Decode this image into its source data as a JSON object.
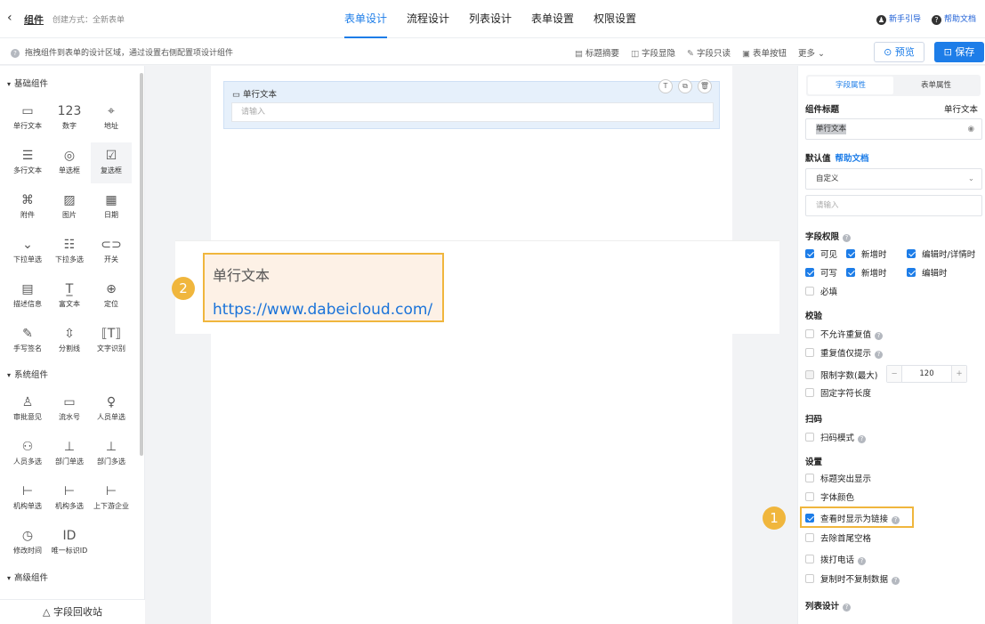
{
  "header": {
    "back_icon": "chevron-left-icon",
    "title": "组件",
    "create_mode": "创建方式：全新表单",
    "tabs": [
      "表单设计",
      "流程设计",
      "列表设计",
      "表单设置",
      "权限设置"
    ],
    "active_tab": "表单设计",
    "guide": "新手引导",
    "help": "帮助文档"
  },
  "toolbar": {
    "hint": "拖拽组件到表单的设计区域，通过设置右侧配置项设计组件",
    "tools": [
      "标题摘要",
      "字段显隐",
      "字段只读",
      "表单按钮",
      "更多"
    ],
    "preview": "预览",
    "save": "保存"
  },
  "left": {
    "basic_title": "基础组件",
    "basic": [
      {
        "label": "单行文本",
        "icon": "▭"
      },
      {
        "label": "数字",
        "icon": "123"
      },
      {
        "label": "地址",
        "icon": "⌖"
      },
      {
        "label": "多行文本",
        "icon": "☰"
      },
      {
        "label": "单选框",
        "icon": "◎"
      },
      {
        "label": "复选框",
        "icon": "☑"
      },
      {
        "label": "附件",
        "icon": "⌘"
      },
      {
        "label": "图片",
        "icon": "▨"
      },
      {
        "label": "日期",
        "icon": "▦"
      },
      {
        "label": "下拉单选",
        "icon": "⌄"
      },
      {
        "label": "下拉多选",
        "icon": "☷"
      },
      {
        "label": "开关",
        "icon": "⊂⊃"
      },
      {
        "label": "描述信息",
        "icon": "▤"
      },
      {
        "label": "富文本",
        "icon": "T̲"
      },
      {
        "label": "定位",
        "icon": "⊕"
      },
      {
        "label": "手写签名",
        "icon": "✎"
      },
      {
        "label": "分割线",
        "icon": "⇳"
      },
      {
        "label": "文字识别",
        "icon": "⟦T⟧"
      }
    ],
    "system_title": "系统组件",
    "system": [
      {
        "label": "审批意见",
        "icon": "♙"
      },
      {
        "label": "流水号",
        "icon": "▭"
      },
      {
        "label": "人员单选",
        "icon": "♀"
      },
      {
        "label": "人员多选",
        "icon": "⚇"
      },
      {
        "label": "部门单选",
        "icon": "⊥"
      },
      {
        "label": "部门多选",
        "icon": "⊥"
      },
      {
        "label": "机构单选",
        "icon": "⊢"
      },
      {
        "label": "机构多选",
        "icon": "⊢"
      },
      {
        "label": "上下游企业",
        "icon": "⊢"
      },
      {
        "label": "修改时间",
        "icon": "◷"
      },
      {
        "label": "唯一标识ID",
        "icon": "ID"
      }
    ],
    "advanced_title": "高级组件",
    "recycle": "△ 字段回收站"
  },
  "canvas": {
    "field_label": "单行文本",
    "field_placeholder": "请输入",
    "card_tools": [
      "T",
      "⧉",
      "🗑"
    ],
    "preview_label": "单行文本",
    "preview_link": "https://www.dabeicloud.com/",
    "badge_2": "2"
  },
  "right": {
    "tab_active": "字段属性",
    "tab_inactive": "表单属性",
    "title_label": "组件标题",
    "title_value": "单行文本",
    "title_input": "单行文本",
    "default_label": "默认值",
    "help_link": "帮助文档",
    "default_select": "自定义",
    "default_placeholder": "请输入",
    "perm_label": "字段权限",
    "perm_row1": [
      "可见",
      "新增时",
      "编辑时/详情时"
    ],
    "perm_row2": [
      "可写",
      "新增时",
      "编辑时"
    ],
    "required": "必填",
    "validate_label": "校验",
    "no_dup": "不允许重复值",
    "dup_hint": "重复值仅提示",
    "limit": "限制字数(最大)",
    "limit_value": "120",
    "fixed_len": "固定字符长度",
    "scan_label": "扫码",
    "scan_mode": "扫码模式",
    "settings_label": "设置",
    "title_highlight": "标题突出显示",
    "font_color": "字体颜色",
    "show_link": "查看时显示为链接",
    "trim": "去除首尾空格",
    "dial": "拨打电话",
    "no_copy": "复制时不复制数据",
    "list_design": "列表设计",
    "badge_1": "1"
  },
  "colors": {
    "accent": "#1d7de8",
    "highlight": "#f0b63d"
  }
}
